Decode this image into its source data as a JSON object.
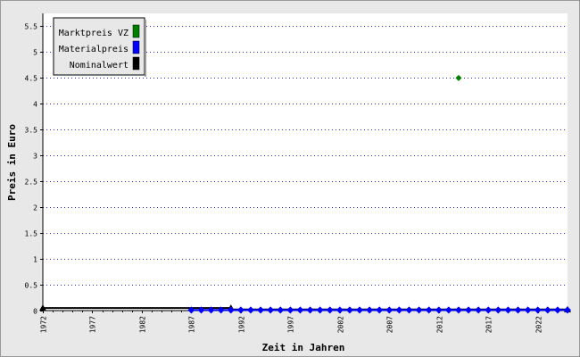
{
  "chart_data": {
    "type": "line",
    "title": "",
    "xlabel": "Zeit in Jahren",
    "ylabel": "Preis in Euro",
    "xlim": [
      1972,
      2025
    ],
    "ylim": [
      0,
      5.75
    ],
    "x_ticks": [
      1972,
      1977,
      1982,
      1987,
      1992,
      1997,
      2002,
      2007,
      2012,
      2017,
      2022
    ],
    "y_ticks": [
      0,
      0.5,
      1,
      1.5,
      2,
      2.5,
      3,
      3.5,
      4,
      4.5,
      5,
      5.5
    ],
    "x_tick_labels": [
      "1972",
      "1977",
      "1982",
      "1987",
      "1992",
      "1997",
      "2002",
      "2007",
      "2012",
      "2017",
      "2022"
    ],
    "y_tick_labels": [
      "0",
      "0.5",
      "1",
      "1.5",
      "2",
      "2.5",
      "3",
      "3.5",
      "4",
      "4.5",
      "5",
      "5.5"
    ],
    "grid": "horizontal dotted",
    "legend_position": "top-left",
    "series": [
      {
        "name": "Marktpreis VZ",
        "color": "#008000",
        "marker": "diamond",
        "points": [
          [
            2014,
            4.5
          ]
        ]
      },
      {
        "name": "Materialpreis",
        "color": "#0000ff",
        "marker": "diamond",
        "points": [
          [
            1987,
            0.01
          ],
          [
            1988,
            0.01
          ],
          [
            1989,
            0.01
          ],
          [
            1990,
            0.01
          ],
          [
            1991,
            0.01
          ],
          [
            1992,
            0.01
          ],
          [
            1993,
            0.01
          ],
          [
            1994,
            0.01
          ],
          [
            1995,
            0.01
          ],
          [
            1996,
            0.01
          ],
          [
            1997,
            0.01
          ],
          [
            1998,
            0.01
          ],
          [
            1999,
            0.01
          ],
          [
            2000,
            0.01
          ],
          [
            2001,
            0.01
          ],
          [
            2002,
            0.01
          ],
          [
            2003,
            0.01
          ],
          [
            2004,
            0.01
          ],
          [
            2005,
            0.01
          ],
          [
            2006,
            0.01
          ],
          [
            2007,
            0.01
          ],
          [
            2008,
            0.01
          ],
          [
            2009,
            0.01
          ],
          [
            2010,
            0.01
          ],
          [
            2011,
            0.01
          ],
          [
            2012,
            0.01
          ],
          [
            2013,
            0.01
          ],
          [
            2014,
            0.01
          ],
          [
            2015,
            0.01
          ],
          [
            2016,
            0.01
          ],
          [
            2017,
            0.01
          ],
          [
            2018,
            0.01
          ],
          [
            2019,
            0.01
          ],
          [
            2020,
            0.01
          ],
          [
            2021,
            0.01
          ],
          [
            2022,
            0.01
          ],
          [
            2023,
            0.01
          ],
          [
            2024,
            0.01
          ],
          [
            2025,
            0.01
          ]
        ]
      },
      {
        "name": "Nominalwert",
        "color": "#000000",
        "marker": "triangle",
        "points": [
          [
            1972,
            0.05
          ],
          [
            1991,
            0.05
          ],
          [
            1991,
            0.02
          ],
          [
            2025,
            0.02
          ]
        ],
        "marker_points": [
          [
            1972,
            0.05
          ],
          [
            1991,
            0.05
          ],
          [
            2025,
            0.02
          ]
        ]
      }
    ]
  }
}
